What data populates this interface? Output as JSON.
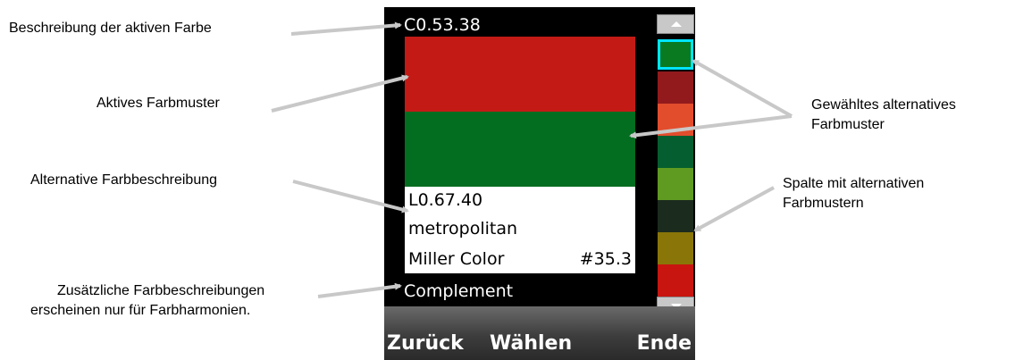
{
  "annotations": {
    "active_color_description": "Beschreibung der aktiven Farbe",
    "active_swatch": "Aktives Farbmuster",
    "alternative_description": "Alternative Farbbeschreibung",
    "additional_descriptions_line1": "Zusätzliche Farbbeschreibungen",
    "additional_descriptions_line2": "erscheinen nur für Farbharmonien.",
    "selected_alternative_line1": "Gewähltes alternatives",
    "selected_alternative_line2": "Farbmuster",
    "alternative_column_line1": "Spalte mit alternativen",
    "alternative_column_line2": "Farbmustern"
  },
  "device": {
    "active_description": "C0.53.38",
    "active_color": "#c31a15",
    "alternative_color": "#036d20",
    "alt_info": {
      "code": "L0.67.40",
      "name": "metropolitan",
      "brand": "Miller Color",
      "number": "#35.3"
    },
    "harmony_label": "Complement",
    "column_chips": [
      "#0a7a20",
      "#921a1c",
      "#e24d2c",
      "#045e2f",
      "#5f9a21",
      "#1b2b1e",
      "#8a7608",
      "#c8150f"
    ],
    "selected_chip_index": 0,
    "softkeys": {
      "back": "Zurück",
      "select": "Wählen",
      "end": "Ende"
    }
  }
}
